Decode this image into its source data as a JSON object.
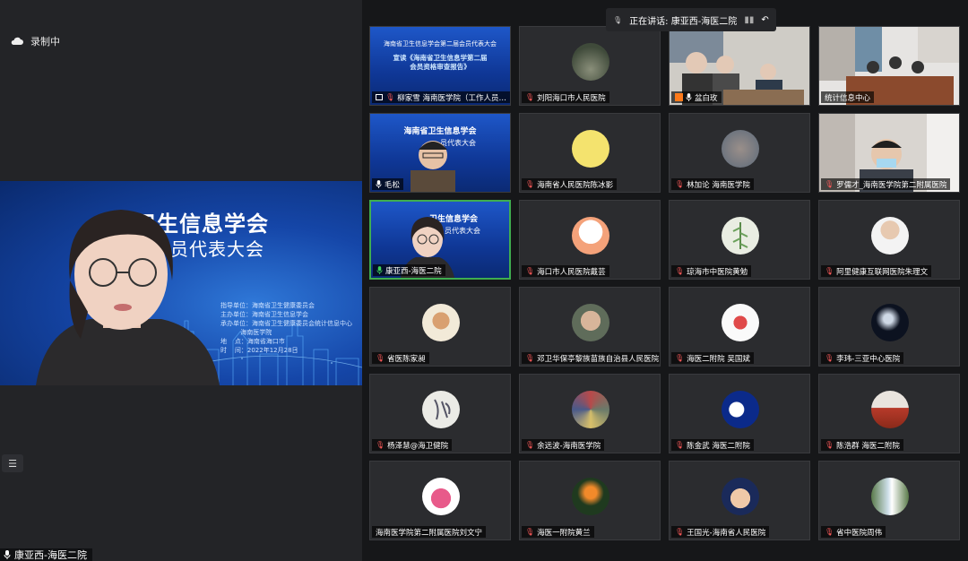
{
  "recording": {
    "label": "录制中"
  },
  "main": {
    "slide_title1": "卫生信息学会",
    "slide_title2": "员代表大会",
    "slide_info": "指导单位：海南省卫生健康委员会\n主办单位：海南省卫生信息学会\n承办单位：海南省卫生健康委员会统计信息中心\n          海南医学院\n地    点：海南省海口市\n时    间：2022年12月28日",
    "name": "康亚西-海医二院"
  },
  "speaking": {
    "label": "正在讲话: 康亚西-海医二院"
  },
  "tiles": [
    {
      "name": "柳家雪 海南医学院（工作人员…",
      "slide_title": "海南省卫生信息学会第二届会员代表大会",
      "slide_sub": "宣读《海南省卫生信息学第二届\n会员资格审查报告》"
    },
    {
      "name": "刘阳海口市人民医院"
    },
    {
      "name": "盆白玫"
    },
    {
      "name": "统计信息中心"
    },
    {
      "name": "毛松",
      "slide_title": "海南省卫生信息学会",
      "slide_sub": "员代表大会"
    },
    {
      "name": "海南省人民医院陈冰影"
    },
    {
      "name": "林加论 海南医学院"
    },
    {
      "name": "罗儒才_海南医学院第二附属医院"
    },
    {
      "name": "康亚西-海医二院",
      "slide_title": "卫生信息学会",
      "slide_sub": "员代表大会"
    },
    {
      "name": "海口市人民医院戴芸"
    },
    {
      "name": "琼海市中医院黄勉"
    },
    {
      "name": "阿里健康互联网医院朱理文"
    },
    {
      "name": "省医陈家昶"
    },
    {
      "name": "邓卫华保亭黎族苗族自治县人民医院"
    },
    {
      "name": "海医二附院 吴国斌"
    },
    {
      "name": "李玮-三亚中心医院"
    },
    {
      "name": "杨泽慧@海卫健院"
    },
    {
      "name": "余远波-海南医学院"
    },
    {
      "name": "陈金武 海医二附院"
    },
    {
      "name": "陈浩群 海医二附院"
    },
    {
      "name": "海南医学院第二附属医院刘文宁"
    },
    {
      "name": "海医一附院黄兰"
    },
    {
      "name": "王国光-海南省人民医院"
    },
    {
      "name": "省中医院周伟"
    }
  ]
}
